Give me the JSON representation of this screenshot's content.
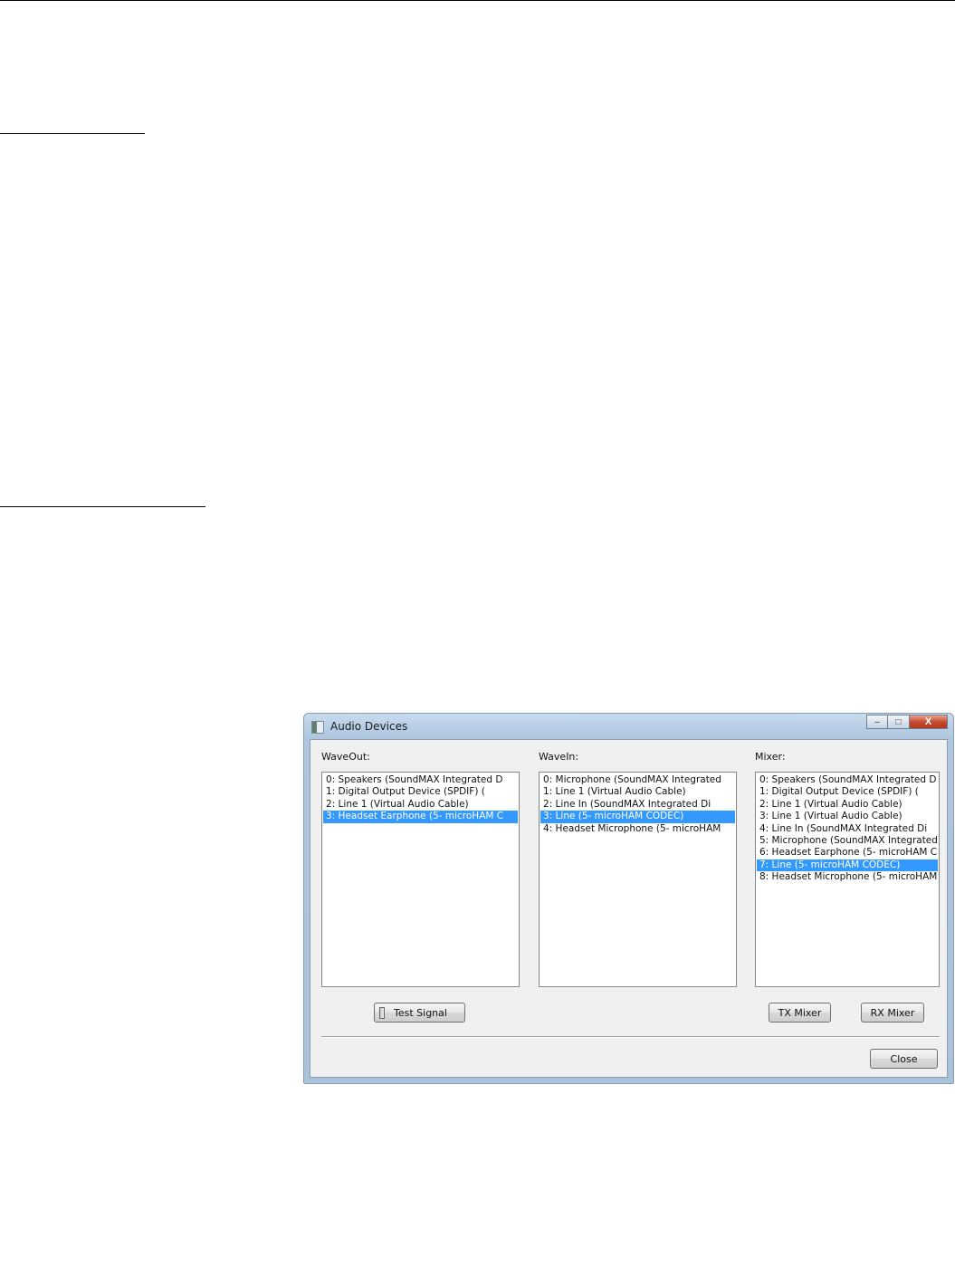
{
  "dialog": {
    "title": "Audio Devices",
    "window_buttons": {
      "minimize": "–",
      "maximize": "□",
      "close": "X"
    },
    "groups": {
      "waveout": {
        "label": "WaveOut:",
        "items": [
          "0: Speakers (SoundMAX Integrated D",
          "1: Digital Output Device (SPDIF) (",
          "2: Line 1 (Virtual Audio Cable)",
          "3: Headset Earphone (5- microHAM C"
        ],
        "selected_index": 3
      },
      "wavein": {
        "label": "WaveIn:",
        "items": [
          "0: Microphone (SoundMAX Integrated",
          "1: Line 1 (Virtual Audio Cable)",
          "2: Line In (SoundMAX Integrated Di",
          "3: Line (5- microHAM CODEC)",
          "4: Headset Microphone (5- microHAM"
        ],
        "selected_index": 3
      },
      "mixer": {
        "label": "Mixer:",
        "items": [
          "0: Speakers (SoundMAX Integrated D",
          "1: Digital Output Device (SPDIF) (",
          "2: Line 1 (Virtual Audio Cable)",
          "3: Line 1 (Virtual Audio Cable)",
          "4: Line In (SoundMAX Integrated Di",
          "5: Microphone (SoundMAX Integrated",
          "6: Headset Earphone (5- microHAM C",
          "7: Line (5- microHAM CODEC)",
          "8: Headset Microphone (5- microHAM"
        ],
        "selected_index": 7
      }
    },
    "buttons": {
      "test_signal": "Test Signal",
      "tx_mixer": "TX Mixer",
      "rx_mixer": "RX Mixer",
      "close": "Close"
    }
  },
  "colors": {
    "selection": "#3399ff",
    "titlebar": "#aec6df"
  }
}
